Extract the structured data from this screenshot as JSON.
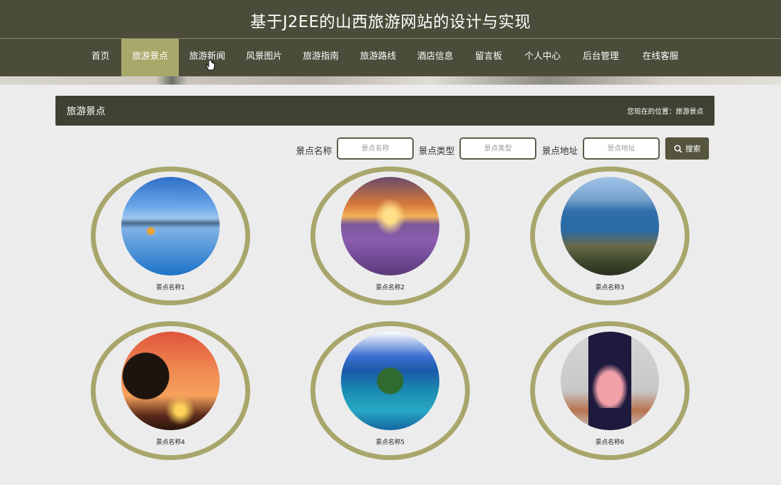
{
  "header": {
    "title": "基于J2EE的山西旅游网站的设计与实现"
  },
  "nav": {
    "items": [
      {
        "label": "首页"
      },
      {
        "label": "旅游景点"
      },
      {
        "label": "旅游新闻"
      },
      {
        "label": "风景图片"
      },
      {
        "label": "旅游指南"
      },
      {
        "label": "旅游路线"
      },
      {
        "label": "酒店信息"
      },
      {
        "label": "留言板"
      },
      {
        "label": "个人中心"
      },
      {
        "label": "后台管理"
      },
      {
        "label": "在线客服"
      }
    ],
    "active_index": 1
  },
  "section": {
    "title": "旅游景点",
    "breadcrumb": "您现在的位置：旅游景点"
  },
  "search": {
    "name_label": "景点名称",
    "name_placeholder": "景点名称",
    "type_label": "景点类型",
    "type_placeholder": "景点类型",
    "address_label": "景点地址",
    "address_placeholder": "景点地址",
    "button_label": "搜索"
  },
  "spots": [
    {
      "name": "景点名称1"
    },
    {
      "name": "景点名称2"
    },
    {
      "name": "景点名称3"
    },
    {
      "name": "景点名称4"
    },
    {
      "name": "景点名称5"
    },
    {
      "name": "景点名称6"
    }
  ],
  "colors": {
    "header_bg": "#4c4c3a",
    "active_nav": "#a8a86a",
    "ring": "#a9a66c",
    "section_bar": "#3d4232"
  }
}
